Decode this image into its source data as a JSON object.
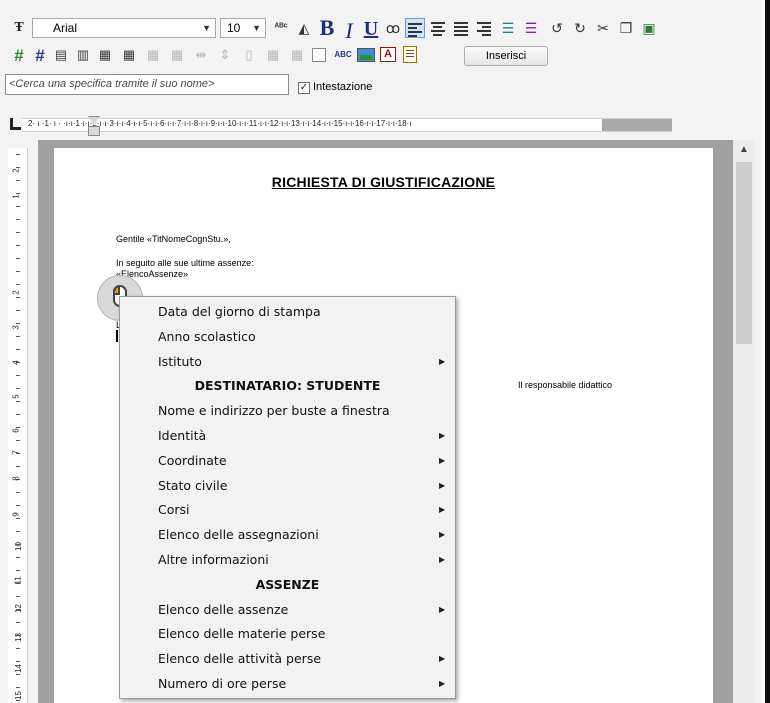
{
  "toolbar": {
    "font_name": "Arial",
    "font_size": "10",
    "insert_button": "Inserisci"
  },
  "search": {
    "placeholder": "<Cerca una specifica tramite il suo nome>",
    "header_checkbox_label": "Intestazione",
    "header_checked": true
  },
  "ruler": {
    "numbers": "2· ı ·1· ı ·  ·ı·ı·1·ı·ı·2·ı·ı·3·ı·ı·4·ı·ı·5·ı·ı·6·ı·ı·7·ı·ı·8·ı·ı·9·ı·ı·10·ı·ı·11·ı·ı·12·ı·ı·13·ı·ı·14·ı·ı·15·ı·ı·16·ı·ı·17·ı·ı·18·ı",
    "vertical_numbers": [
      "2",
      "1",
      "2",
      "3",
      "4",
      "5",
      "6",
      "7",
      "8",
      "9",
      "10",
      "11",
      "12",
      "13",
      "14",
      "15"
    ]
  },
  "document": {
    "title": "RICHIESTA DI GIUSTIFICAZIONE",
    "greeting": "Gentile «TitNomeCognStu.»,",
    "line1": "In seguito alle sue ultime assenze:",
    "line2": "«ElencoAssenze»",
    "partial_char": "L",
    "signature": "Il responsabile didattico"
  },
  "context_menu": {
    "items": [
      {
        "label": "Data del giorno di stampa",
        "submenu": false,
        "header": false
      },
      {
        "label": "Anno scolastico",
        "submenu": false,
        "header": false
      },
      {
        "label": "Istituto",
        "submenu": true,
        "header": false
      },
      {
        "label": "DESTINATARIO: STUDENTE",
        "submenu": false,
        "header": true
      },
      {
        "label": "Nome e indirizzo per buste a finestra",
        "submenu": false,
        "header": false
      },
      {
        "label": "Identità",
        "submenu": true,
        "header": false
      },
      {
        "label": "Coordinate",
        "submenu": true,
        "header": false
      },
      {
        "label": "Stato civile",
        "submenu": true,
        "header": false
      },
      {
        "label": "Corsi",
        "submenu": true,
        "header": false
      },
      {
        "label": "Elenco delle assegnazioni",
        "submenu": true,
        "header": false
      },
      {
        "label": "Altre informazioni",
        "submenu": true,
        "header": false
      },
      {
        "label": "ASSENZE",
        "submenu": false,
        "header": true
      },
      {
        "label": "Elenco delle assenze",
        "submenu": true,
        "header": false
      },
      {
        "label": "Elenco delle materie perse",
        "submenu": false,
        "header": false
      },
      {
        "label": "Elenco delle attività perse",
        "submenu": true,
        "header": false
      },
      {
        "label": "Numero di ore perse",
        "submenu": true,
        "header": false
      }
    ]
  },
  "colors": {
    "accent": "#1d2f7a",
    "selected_toggle": "#cfe4fa",
    "mouse_button": "#f6a000"
  }
}
